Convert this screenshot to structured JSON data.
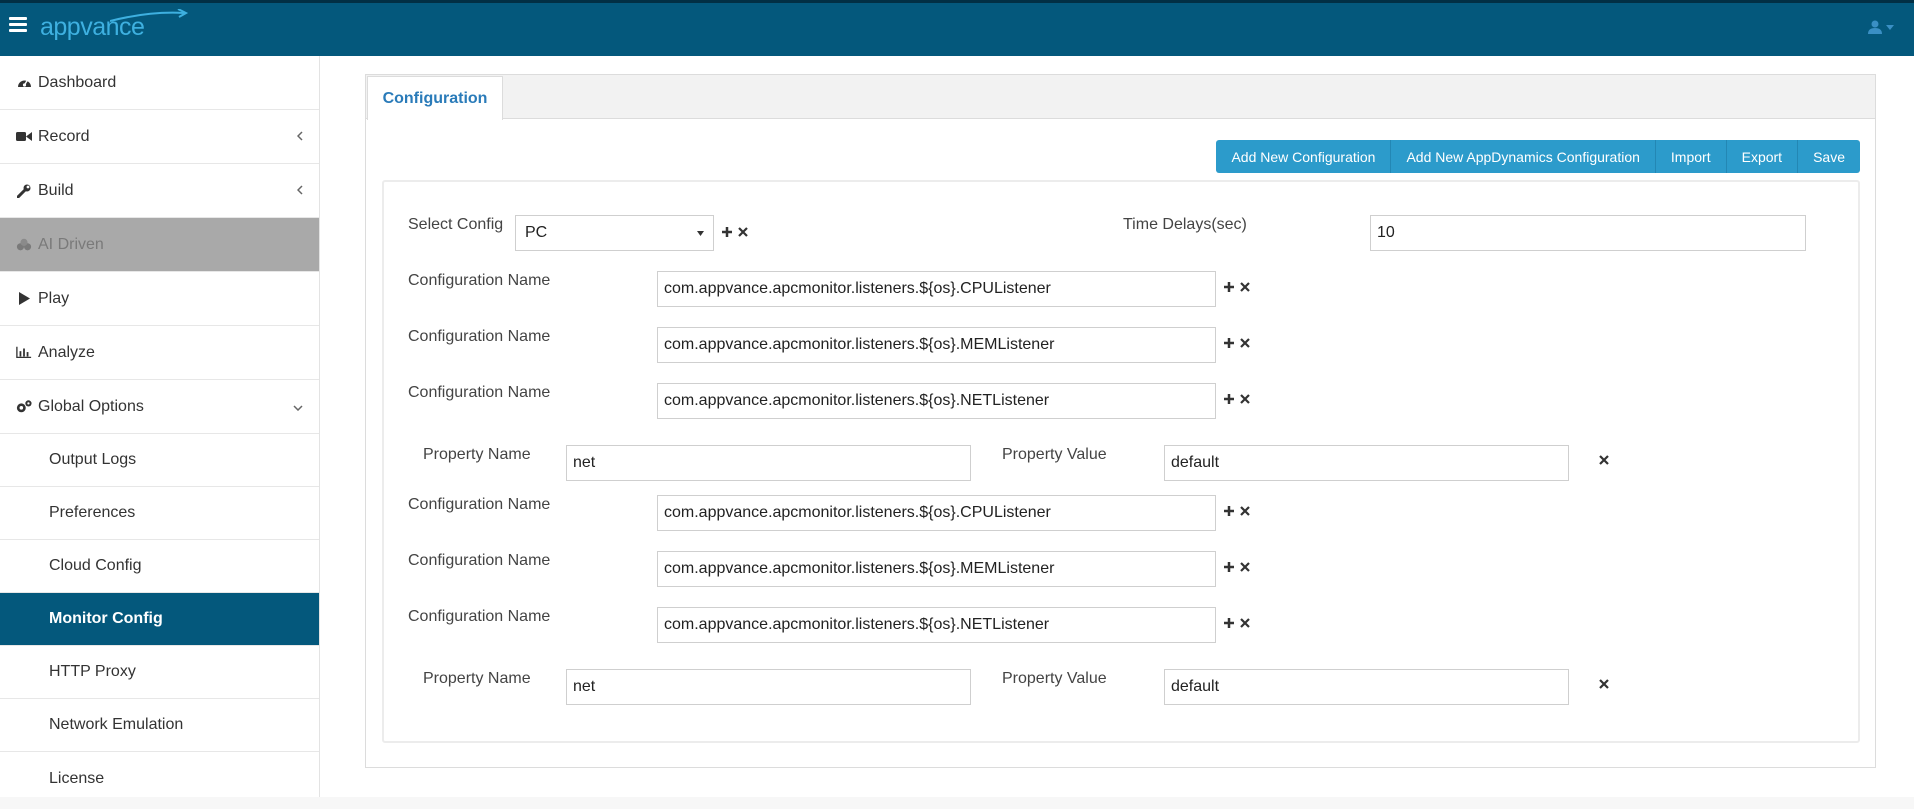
{
  "app": {
    "logo_text": "appvance"
  },
  "sidebar": {
    "items": [
      {
        "label": "Dashboard",
        "icon": "dashboard-icon"
      },
      {
        "label": "Record",
        "icon": "video-camera-icon"
      },
      {
        "label": "Build",
        "icon": "wrench-icon"
      },
      {
        "label": "AI Driven",
        "icon": "cubes-icon"
      },
      {
        "label": "Play",
        "icon": "play-icon"
      },
      {
        "label": "Analyze",
        "icon": "bar-chart-icon"
      },
      {
        "label": "Global Options",
        "icon": "gears-icon"
      }
    ],
    "sub_items": [
      {
        "label": "Output Logs"
      },
      {
        "label": "Preferences"
      },
      {
        "label": "Cloud Config"
      },
      {
        "label": "Monitor Config"
      },
      {
        "label": "HTTP Proxy"
      },
      {
        "label": "Network Emulation"
      },
      {
        "label": "License"
      }
    ]
  },
  "main": {
    "tab_label": "Configuration",
    "buttons": [
      "Add New Configuration",
      "Add New AppDynamics Configuration",
      "Import",
      "Export",
      "Save"
    ],
    "select_config_label": "Select Config",
    "select_config_value": "PC",
    "time_delays_label": "Time Delays(sec)",
    "time_delays_value": "10",
    "rows": [
      {
        "label": "Configuration Name",
        "value": "com.appvance.apcmonitor.listeners.${os}.CPUListener"
      },
      {
        "label": "Configuration Name",
        "value": "com.appvance.apcmonitor.listeners.${os}.MEMListener"
      },
      {
        "label": "Configuration Name",
        "value": "com.appvance.apcmonitor.listeners.${os}.NETListener"
      },
      {
        "label": "Configuration Name",
        "value": "com.appvance.apcmonitor.listeners.${os}.CPUListener"
      },
      {
        "label": "Configuration Name",
        "value": "com.appvance.apcmonitor.listeners.${os}.MEMListener"
      },
      {
        "label": "Configuration Name",
        "value": "com.appvance.apcmonitor.listeners.${os}.NETListener"
      }
    ],
    "properties": [
      {
        "name_label": "Property Name",
        "name_value": "net",
        "value_label": "Property Value",
        "value_value": "default"
      },
      {
        "name_label": "Property Name",
        "name_value": "net",
        "value_label": "Property Value",
        "value_value": "default"
      }
    ]
  },
  "colors": {
    "topbar": "#04587c",
    "accent": "#2c9bcb",
    "active_nav": "#04587c",
    "tab_text": "#2a7bb9"
  }
}
